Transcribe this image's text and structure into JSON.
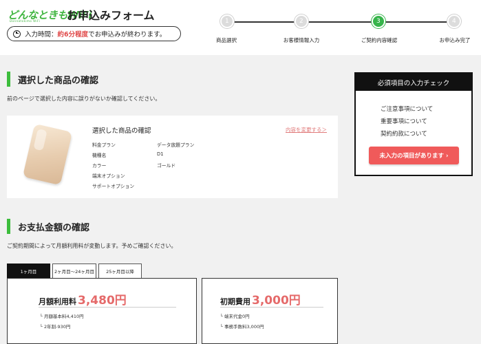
{
  "header": {
    "logo": "どんなときもWiFi",
    "logo_sub": "Donnatokimo WiFi",
    "title": "お申込みフォーム",
    "time_prefix": "入力時間：",
    "time_highlight": "約6分程度",
    "time_suffix": "でお申込みが終わります。"
  },
  "steps": [
    {
      "num": "1",
      "label": "商品選択",
      "active": false
    },
    {
      "num": "2",
      "label": "お客様情報入力",
      "active": false
    },
    {
      "num": "3",
      "label": "ご契約内容確認",
      "active": true
    },
    {
      "num": "4",
      "label": "お申込み完了",
      "active": false
    }
  ],
  "product_section": {
    "heading": "選択した商品の確認",
    "description": "前のページで選択した内容に誤りがないか確認してください。",
    "card_title": "選択した商品の確認",
    "change_link": "内容を変更する＞",
    "specs": [
      {
        "label": "料金プラン",
        "value": "データ放題プラン"
      },
      {
        "label": "機種名",
        "value": "D1"
      },
      {
        "label": "カラー",
        "value": "ゴールド"
      },
      {
        "label": "端末オプション",
        "value": ""
      },
      {
        "label": "サポートオプション",
        "value": ""
      }
    ]
  },
  "check_panel": {
    "title": "必須項目の入力チェック",
    "items": [
      "ご注意事項について",
      "重要事項について",
      "契約約款について"
    ],
    "button": "未入力の項目があります ›"
  },
  "payment_section": {
    "heading": "お支払金額の確認",
    "description": "ご契約期間によって月額利用料が変動します。予めご確認ください。",
    "tabs": [
      "1ヶ月目",
      "2ヶ月目〜24ヶ月目",
      "25ヶ月目以降"
    ],
    "monthly": {
      "label": "月額利用料",
      "amount": "3,480円",
      "notes": [
        "└ 月額基本料4,410円",
        "└ 2年割-930円"
      ]
    },
    "initial": {
      "label": "初期費用",
      "amount": "3,000円",
      "notes": [
        "└ 端末代金0円",
        "└ 事務手数料3,000円"
      ]
    }
  },
  "colors": {
    "accent_green": "#3cbd3c",
    "step_active": "#36b44a",
    "alert_red": "#f05a5a",
    "price_red": "#e56a6a"
  }
}
